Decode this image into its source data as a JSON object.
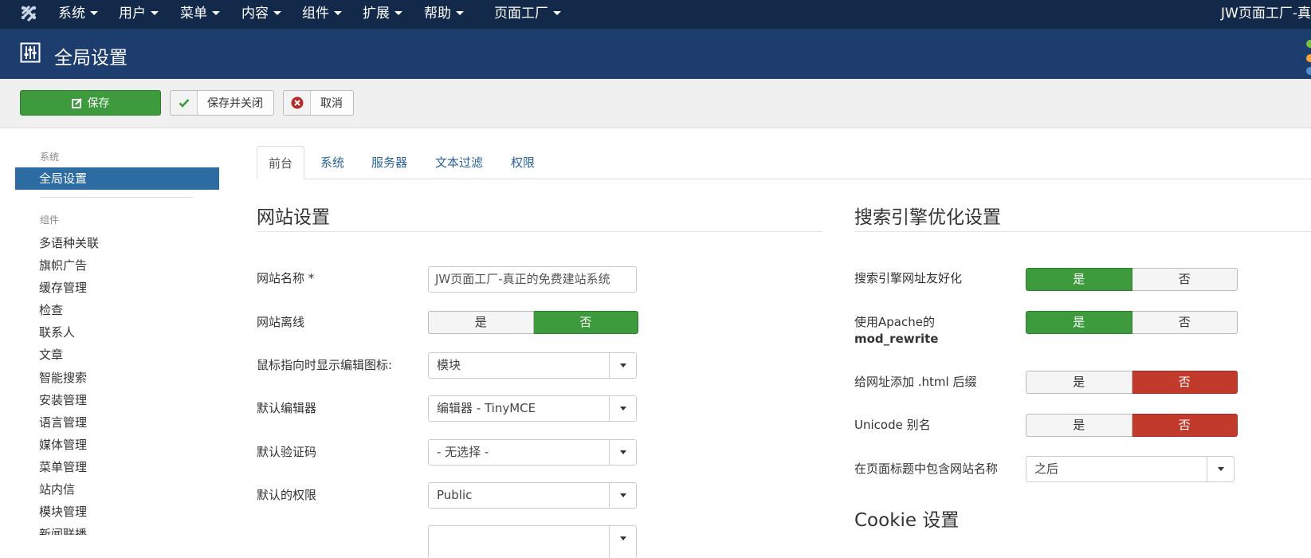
{
  "topnav": {
    "menu": [
      "系统",
      "用户",
      "菜单",
      "内容",
      "组件",
      "扩展",
      "帮助",
      "页面工厂"
    ],
    "site_link": "JW页面工厂-真"
  },
  "header": {
    "title": "全局设置"
  },
  "toolbar": {
    "save": "保存",
    "save_close": "保存并关闭",
    "cancel": "取消"
  },
  "sidebar": {
    "system_heading": "系统",
    "active_item": "全局设置",
    "components_heading": "组件",
    "items": [
      "多语种关联",
      "旗帜广告",
      "缓存管理",
      "检查",
      "联系人",
      "文章",
      "智能搜索",
      "安装管理",
      "语言管理",
      "媒体管理",
      "菜单管理",
      "站内信",
      "模块管理",
      "新闻联播"
    ]
  },
  "tabs": [
    "前台",
    "系统",
    "服务器",
    "文本过滤",
    "权限"
  ],
  "site_settings": {
    "title": "网站设置",
    "site_name_label": "网站名称 *",
    "site_name_value": "JW页面工厂-真正的免费建站系统",
    "offline_label": "网站离线",
    "offline_yes": "是",
    "offline_no": "否",
    "edit_icons_label": "鼠标指向时显示编辑图标:",
    "edit_icons_value": "模块",
    "editor_label": "默认编辑器",
    "editor_value": "编辑器 - TinyMCE",
    "captcha_label": "默认验证码",
    "captcha_value": "- 无选择 -",
    "access_label": "默认的权限",
    "access_value": "Public"
  },
  "seo_settings": {
    "title": "搜索引擎优化设置",
    "sef_label": "搜索引擎网址友好化",
    "rewrite_label_1": "使用Apache的",
    "rewrite_label_2": "mod_rewrite",
    "suffix_label": "给网址添加 .html 后缀",
    "unicode_label": "Unicode 别名",
    "sitename_label": "在页面标题中包含网站名称",
    "sitename_value": "之后",
    "yes": "是",
    "no": "否"
  },
  "cookie_settings": {
    "title": "Cookie 设置"
  },
  "colors": {
    "nav": "#13294a",
    "header": "#1c3d6e",
    "green": "#3d9b3d",
    "red": "#c23a2c",
    "active_blue": "#2d6ca2"
  }
}
